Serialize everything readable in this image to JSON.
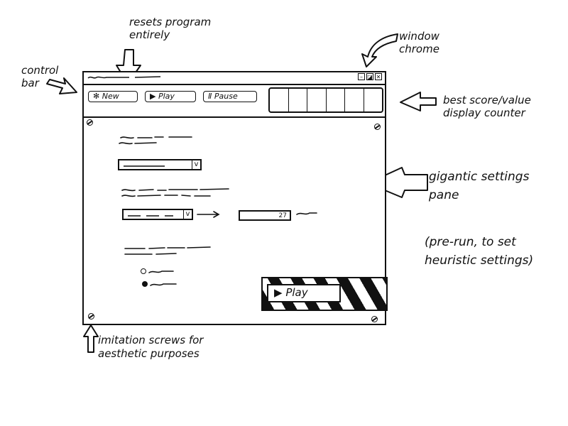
{
  "controlbar": {
    "new_label": "New",
    "play_label": "Play",
    "pause_label": "Pause"
  },
  "settings": {
    "number_value": "27"
  },
  "big_play_label": "Play",
  "annotations": {
    "resets": "resets program entirely",
    "window_chrome": "window chrome",
    "control_bar": "control bar",
    "best_score": "best score/value display counter",
    "gigantic": "gigantic settings pane",
    "prerun": "(pre-run, to set heuristic settings)",
    "screws": "imitation screws for aesthetic purposes"
  },
  "icons": {
    "new": "sparkle-icon",
    "play": "play-icon",
    "pause": "pause-icon"
  }
}
